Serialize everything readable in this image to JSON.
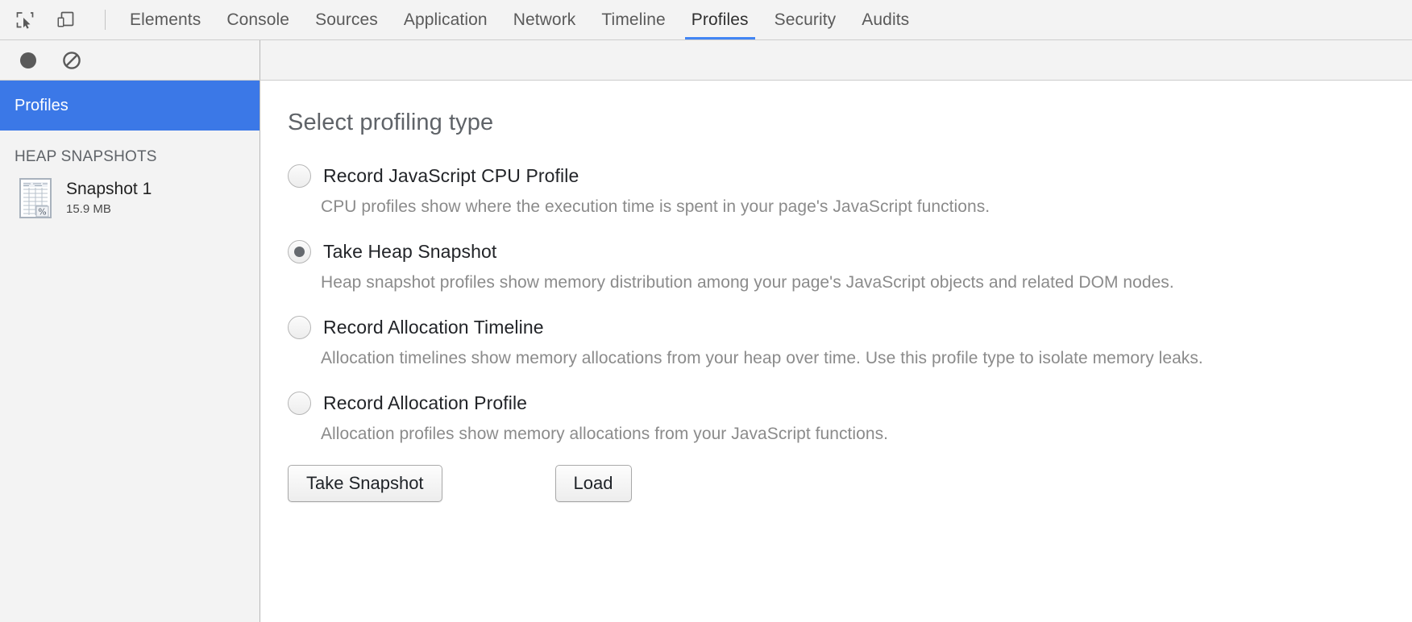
{
  "toolbar": {
    "inspect_icon": "inspect-element-icon",
    "device_icon": "device-toolbar-icon",
    "tabs": [
      {
        "label": "Elements",
        "active": false
      },
      {
        "label": "Console",
        "active": false
      },
      {
        "label": "Sources",
        "active": false
      },
      {
        "label": "Application",
        "active": false
      },
      {
        "label": "Network",
        "active": false
      },
      {
        "label": "Timeline",
        "active": false
      },
      {
        "label": "Profiles",
        "active": true
      },
      {
        "label": "Security",
        "active": false
      },
      {
        "label": "Audits",
        "active": false
      }
    ],
    "active_tab_underline_color": "#4285f4"
  },
  "subtoolbar": {
    "record_icon": "record-circle-icon",
    "clear_icon": "clear-no-entry-icon"
  },
  "sidebar": {
    "header_label": "Profiles",
    "header_color": "#3b78e7",
    "section_label": "HEAP SNAPSHOTS",
    "snapshots": [
      {
        "icon": "heap-snapshot-document-icon",
        "name": "Snapshot 1",
        "size": "15.9 MB"
      }
    ]
  },
  "main": {
    "title": "Select profiling type",
    "options": [
      {
        "id": "cpu-profile",
        "label": "Record JavaScript CPU Profile",
        "description": "CPU profiles show where the execution time is spent in your page's JavaScript functions.",
        "selected": false
      },
      {
        "id": "heap-snapshot",
        "label": "Take Heap Snapshot",
        "description": "Heap snapshot profiles show memory distribution among your page's JavaScript objects and related DOM nodes.",
        "selected": true
      },
      {
        "id": "allocation-timeline",
        "label": "Record Allocation Timeline",
        "description": "Allocation timelines show memory allocations from your heap over time. Use this profile type to isolate memory leaks.",
        "selected": false
      },
      {
        "id": "allocation-profile",
        "label": "Record Allocation Profile",
        "description": "Allocation profiles show memory allocations from your JavaScript functions.",
        "selected": false
      }
    ],
    "take_snapshot_button": "Take Snapshot",
    "load_button": "Load"
  }
}
